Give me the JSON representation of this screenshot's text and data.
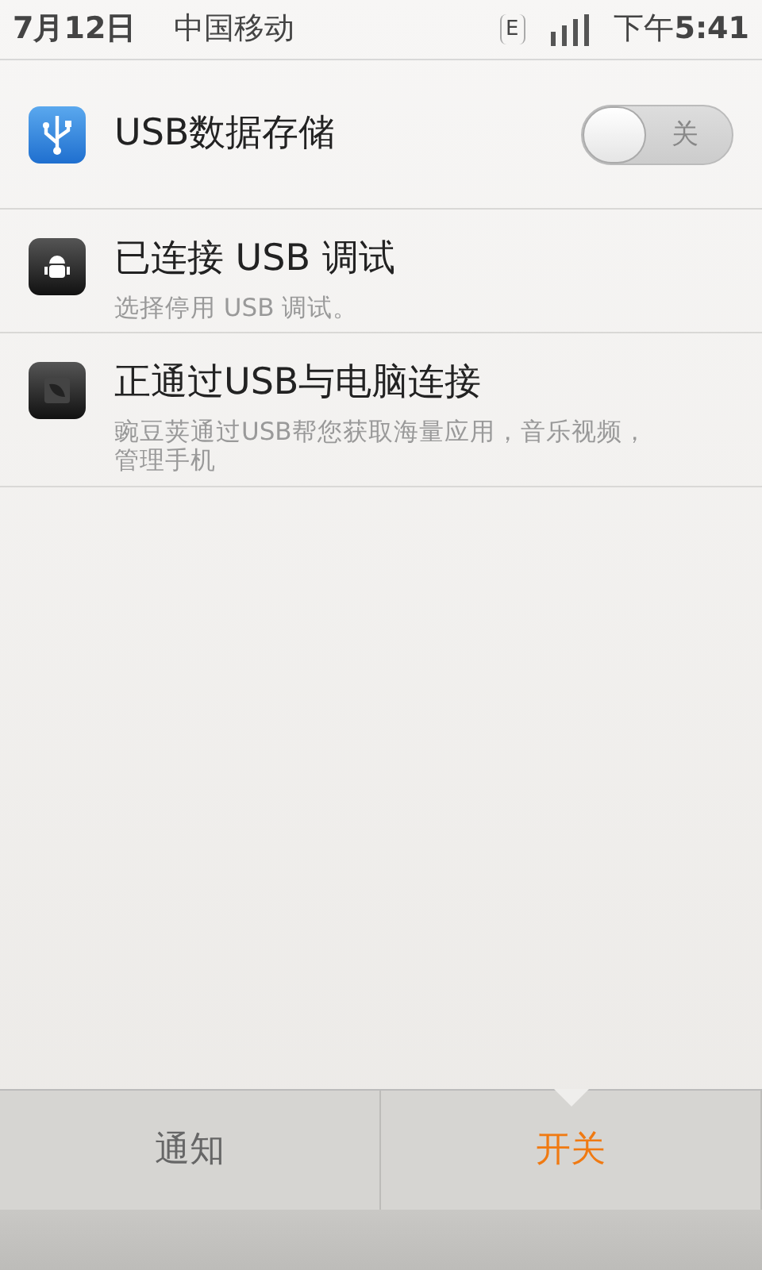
{
  "status_bar": {
    "date": "7月12日",
    "carrier": "中国移动",
    "network": "E",
    "time_prefix": "下午",
    "time": "5:41"
  },
  "items": [
    {
      "kind": "toggle",
      "title": "USB数据存储",
      "on": false,
      "toggle_label": "关"
    },
    {
      "kind": "info",
      "title": "已连接 USB 调试",
      "subtitle": "选择停用 USB 调试。"
    },
    {
      "kind": "info",
      "title": "正通过USB与电脑连接",
      "subtitle": "豌豆荚通过USB帮您获取海量应用，音乐视频，管理手机"
    }
  ],
  "tabs": [
    {
      "label": "通知",
      "selected": false
    },
    {
      "label": "开关",
      "selected": true
    }
  ]
}
